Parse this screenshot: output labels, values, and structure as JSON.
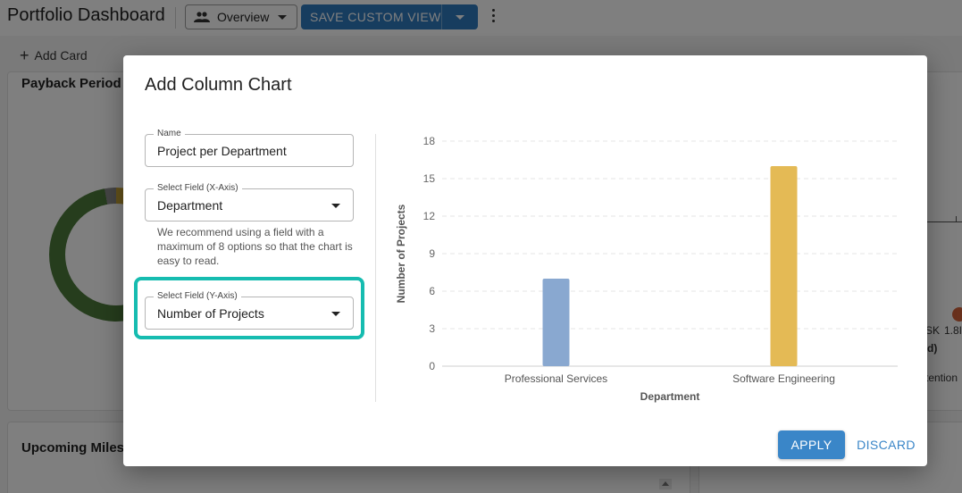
{
  "header": {
    "title": "Portfolio Dashboard",
    "view_select": {
      "value": "Overview",
      "icon": "people-icon"
    },
    "save_view_label": "SAVE CUSTOM VIEW",
    "more_icon": "kebab-icon"
  },
  "toolbar": {
    "add_card_label": "Add Card"
  },
  "background_cards": {
    "payback_title": "Payback Period",
    "milestones_title": "Upcoming Miles",
    "right_card_texts": [
      "SK",
      "1.8I",
      "d)",
      "tention"
    ]
  },
  "dialog": {
    "title": "Add Column Chart",
    "name_field": {
      "label": "Name",
      "value": "Project per Department"
    },
    "x_field": {
      "label": "Select Field (X-Axis)",
      "value": "Department"
    },
    "x_helper": "We recommend using a field with a maximum of 8 options so that the chart is easy to read.",
    "y_field": {
      "label": "Select Field (Y-Axis)",
      "value": "Number of Projects"
    },
    "apply_label": "APPLY",
    "discard_label": "DISCARD"
  },
  "colors": {
    "primary": "#3a86c8",
    "highlight": "#16bcb0",
    "bar_professional": "#89a8d0",
    "bar_software": "#e4ba55"
  },
  "chart_data": {
    "type": "bar",
    "categories": [
      "Professional Services",
      "Software Engineering"
    ],
    "values": [
      7,
      16
    ],
    "xlabel": "Department",
    "ylabel": "Number of Projects",
    "ylim": [
      0,
      18
    ],
    "yticks": [
      "0",
      "3",
      "6",
      "9",
      "12",
      "15",
      "18"
    ],
    "grid": true,
    "bar_colors": [
      "#89a8d0",
      "#e4ba55"
    ]
  }
}
